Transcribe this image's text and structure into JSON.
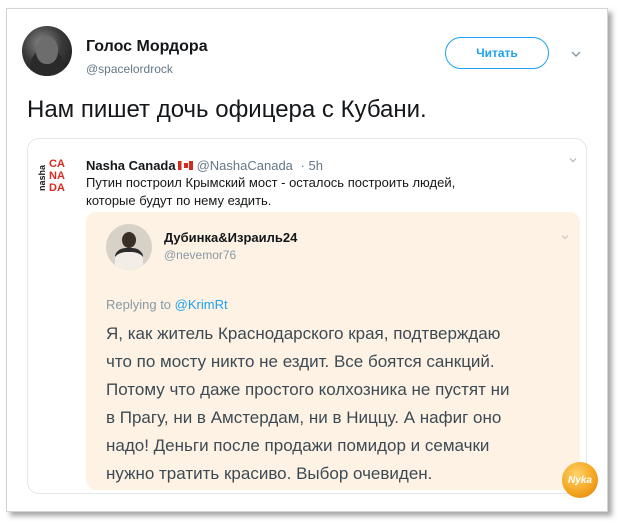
{
  "author": {
    "name": "Голос Мордора",
    "handle": "@spacelordrock",
    "follow_label": "Читать"
  },
  "tweet_text": "Нам пишет дочь офицера с Кубани.",
  "quoted": {
    "name": "Nasha Canada",
    "handle": "@NashaCanada",
    "time": "· 5h",
    "logo_text": "nasha CA NA DA",
    "text_line1": "Путин построил Крымский мост - осталось построить людей,",
    "text_line2": "которые будут по нему ездить."
  },
  "inner": {
    "name": "Дубинка&Израиль24",
    "handle": "@nevemor76",
    "replying_prefix": "Replying to",
    "replying_to": "@KrimRt",
    "lines": [
      "Я, как житель Краснодарского края, подтверждаю",
      "что по мосту никто не ездит. Все боятся санкций.",
      "Потому что даже простого колхозника не пустят ни",
      "в Прагу, ни в Амстердам, ни в Ниццу. А нафиг оно",
      "надо! Деньги после продажи помидор и семачки",
      "нужно тратить красиво. Выбор очевиден."
    ]
  },
  "watermark_text": "Nyka",
  "colors": {
    "accent": "#1da1f2",
    "quote_bg": "#fdf2e3",
    "logo_red": "#d52b1e"
  }
}
